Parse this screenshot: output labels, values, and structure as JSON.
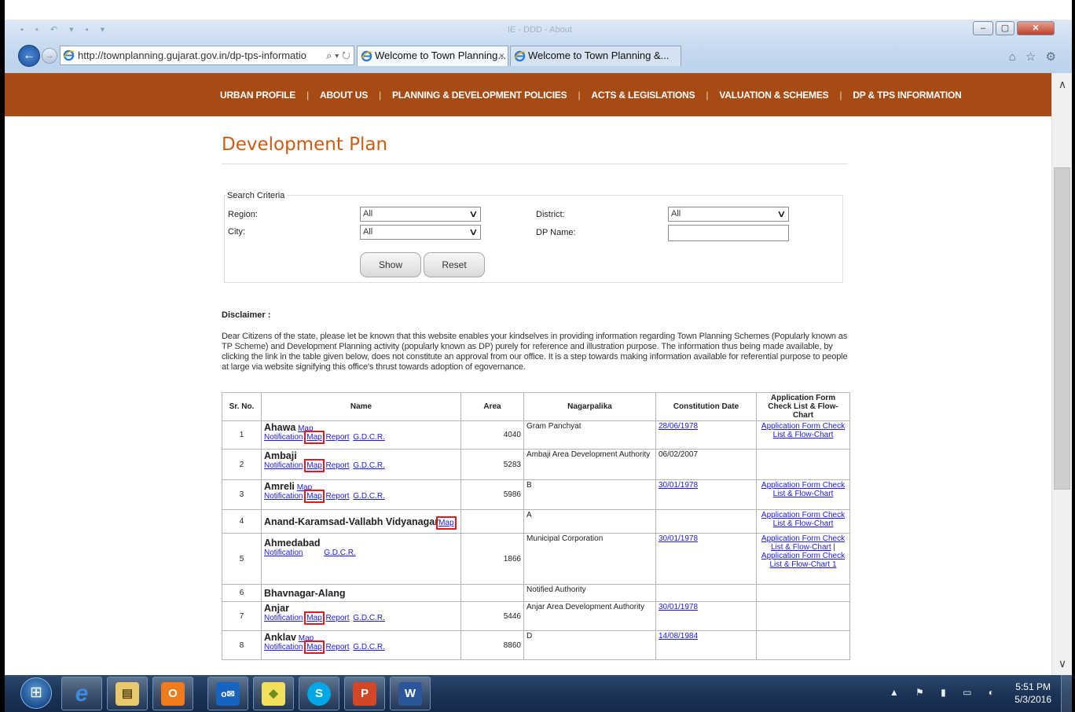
{
  "browser": {
    "title_faint": "IE - DDD - About",
    "address": "http://townplanning.gujarat.gov.in/dp-tps-informatio",
    "tabs": [
      {
        "label": "Welcome to Town Planning...",
        "close": "×"
      },
      {
        "label": "Welcome to Town Planning &..."
      }
    ],
    "window_buttons": {
      "minimize": "–",
      "restore": "▢",
      "close": "✕"
    },
    "toolbar_icons": "⌂ ☆ ⚙"
  },
  "nav": {
    "items": [
      "URBAN PROFILE",
      "ABOUT US",
      "PLANNING & DEVELOPMENT POLICIES",
      "ACTS & LEGISLATIONS",
      "VALUATION & SCHEMES",
      "DP & TPS INFORMATION"
    ],
    "separator": "|"
  },
  "page": {
    "title": "Development Plan"
  },
  "search": {
    "legend": "Search Criteria",
    "region_label": "Region:",
    "region_value": "All",
    "district_label": "District:",
    "district_value": "All",
    "city_label": "City:",
    "city_value": "All",
    "dp_name_label": "DP Name:",
    "dp_name_value": "",
    "show_label": "Show",
    "reset_label": "Reset"
  },
  "disclaimer": {
    "heading": "Disclaimer :",
    "text": "Dear Citizens of the state, please let be known that this website enables your kindselves in providing information regarding Town Planning Schemes (Popularly known as TP Scheme) and Development Planning activity (popularly known as DP) purely for reference and illustration purpose. The information thus being made available, by clicking the link in the table given below, does not constitute an approval from our office. It is a step towards making information available for referential purpose to people at large via website signifying this office's thrust towards adoption of egovernance."
  },
  "table": {
    "headers": [
      "Sr. No.",
      "Name",
      "Area",
      "Nagarpalika",
      "Constitution Date",
      "Application Form Check List & Flow-Chart"
    ],
    "rows": [
      {
        "sr": "1",
        "name": "Ahawa",
        "name_map": "Map",
        "links": [
          "Notification",
          "Map",
          "Report",
          "G.D.C.R."
        ],
        "area": "4040",
        "nagarpalika": "Gram Panchyat",
        "date": "28/06/1978",
        "app": "Application Form Check List & Flow-Chart",
        "app2": ""
      },
      {
        "sr": "2",
        "name": "Ambaji",
        "name_map": "",
        "links": [
          "Notification",
          "Map",
          "Report",
          "G.D.C.R."
        ],
        "area": "5283",
        "nagarpalika": "Ambaji Area Development Authority",
        "date_plain": "06/02/2007",
        "date": "",
        "app": "",
        "app2": ""
      },
      {
        "sr": "3",
        "name": "Amreli",
        "name_map": "Map",
        "links": [
          "Notification",
          "Map",
          "Report",
          "G.D.C.R."
        ],
        "area": "5986",
        "nagarpalika": "B",
        "date": "30/01/1978",
        "app": "Application Form Check List & Flow-Chart",
        "app2": ""
      },
      {
        "sr": "4",
        "name": "Anand-Karamsad-Vallabh Vidyanagar",
        "name_map": "Map",
        "links": [],
        "area": "",
        "nagarpalika": "A",
        "date": "",
        "app": "Application Form Check List & Flow-Chart",
        "app2": ""
      },
      {
        "sr": "5",
        "name": "Ahmedabad",
        "name_map": "",
        "links": [
          "Notification",
          "G.D.C.R."
        ],
        "area": "1866",
        "nagarpalika": "Municipal Corporation",
        "date": "30/01/1978",
        "app": "Application Form Check List & Flow-Chart",
        "app_sep": "|",
        "app2": "Application Form Check List & Flow-Chart 1"
      },
      {
        "sr": "6",
        "name": "Bhavnagar-Alang",
        "name_map": "",
        "links": [],
        "area": "",
        "nagarpalika": "Notified Authority",
        "date": "",
        "app": "",
        "app2": ""
      },
      {
        "sr": "7",
        "name": "Anjar",
        "name_map": "",
        "links": [
          "Notification",
          "Map",
          "Report",
          "G.D.C.R."
        ],
        "area": "5446",
        "nagarpalika": "Anjar Area Development Authority",
        "date": "30/01/1978",
        "app": "",
        "app2": ""
      },
      {
        "sr": "8",
        "name": "Anklav",
        "name_map": "Map",
        "links": [
          "Notification",
          "Map",
          "Report",
          "G.D.C.R."
        ],
        "area": "8860",
        "nagarpalika": "D",
        "date": "14/08/1984",
        "app": "",
        "app2": ""
      }
    ]
  },
  "taskbar": {
    "apps": [
      {
        "icon": "ie-icon",
        "glyph": "e"
      },
      {
        "icon": "file-explorer-icon",
        "glyph": "▤"
      },
      {
        "icon": "outlook-icon",
        "glyph": "O"
      },
      {
        "icon": "outlook-mail-icon",
        "glyph": "o✉"
      },
      {
        "icon": "stickies-icon",
        "glyph": "◆"
      },
      {
        "icon": "skype-icon",
        "glyph": "S"
      },
      {
        "icon": "powerpoint-icon",
        "glyph": "P"
      },
      {
        "icon": "word-icon",
        "glyph": "W"
      }
    ],
    "tray_icons": "▲ ⚑ ▮ ▭ ◐",
    "time": "5:51 PM",
    "date": "5/3/2016"
  },
  "colors": {
    "nav_bg": "#a64b13",
    "title": "#cc5c14",
    "link": "#1a1aee",
    "highlight": "#e0191d"
  }
}
